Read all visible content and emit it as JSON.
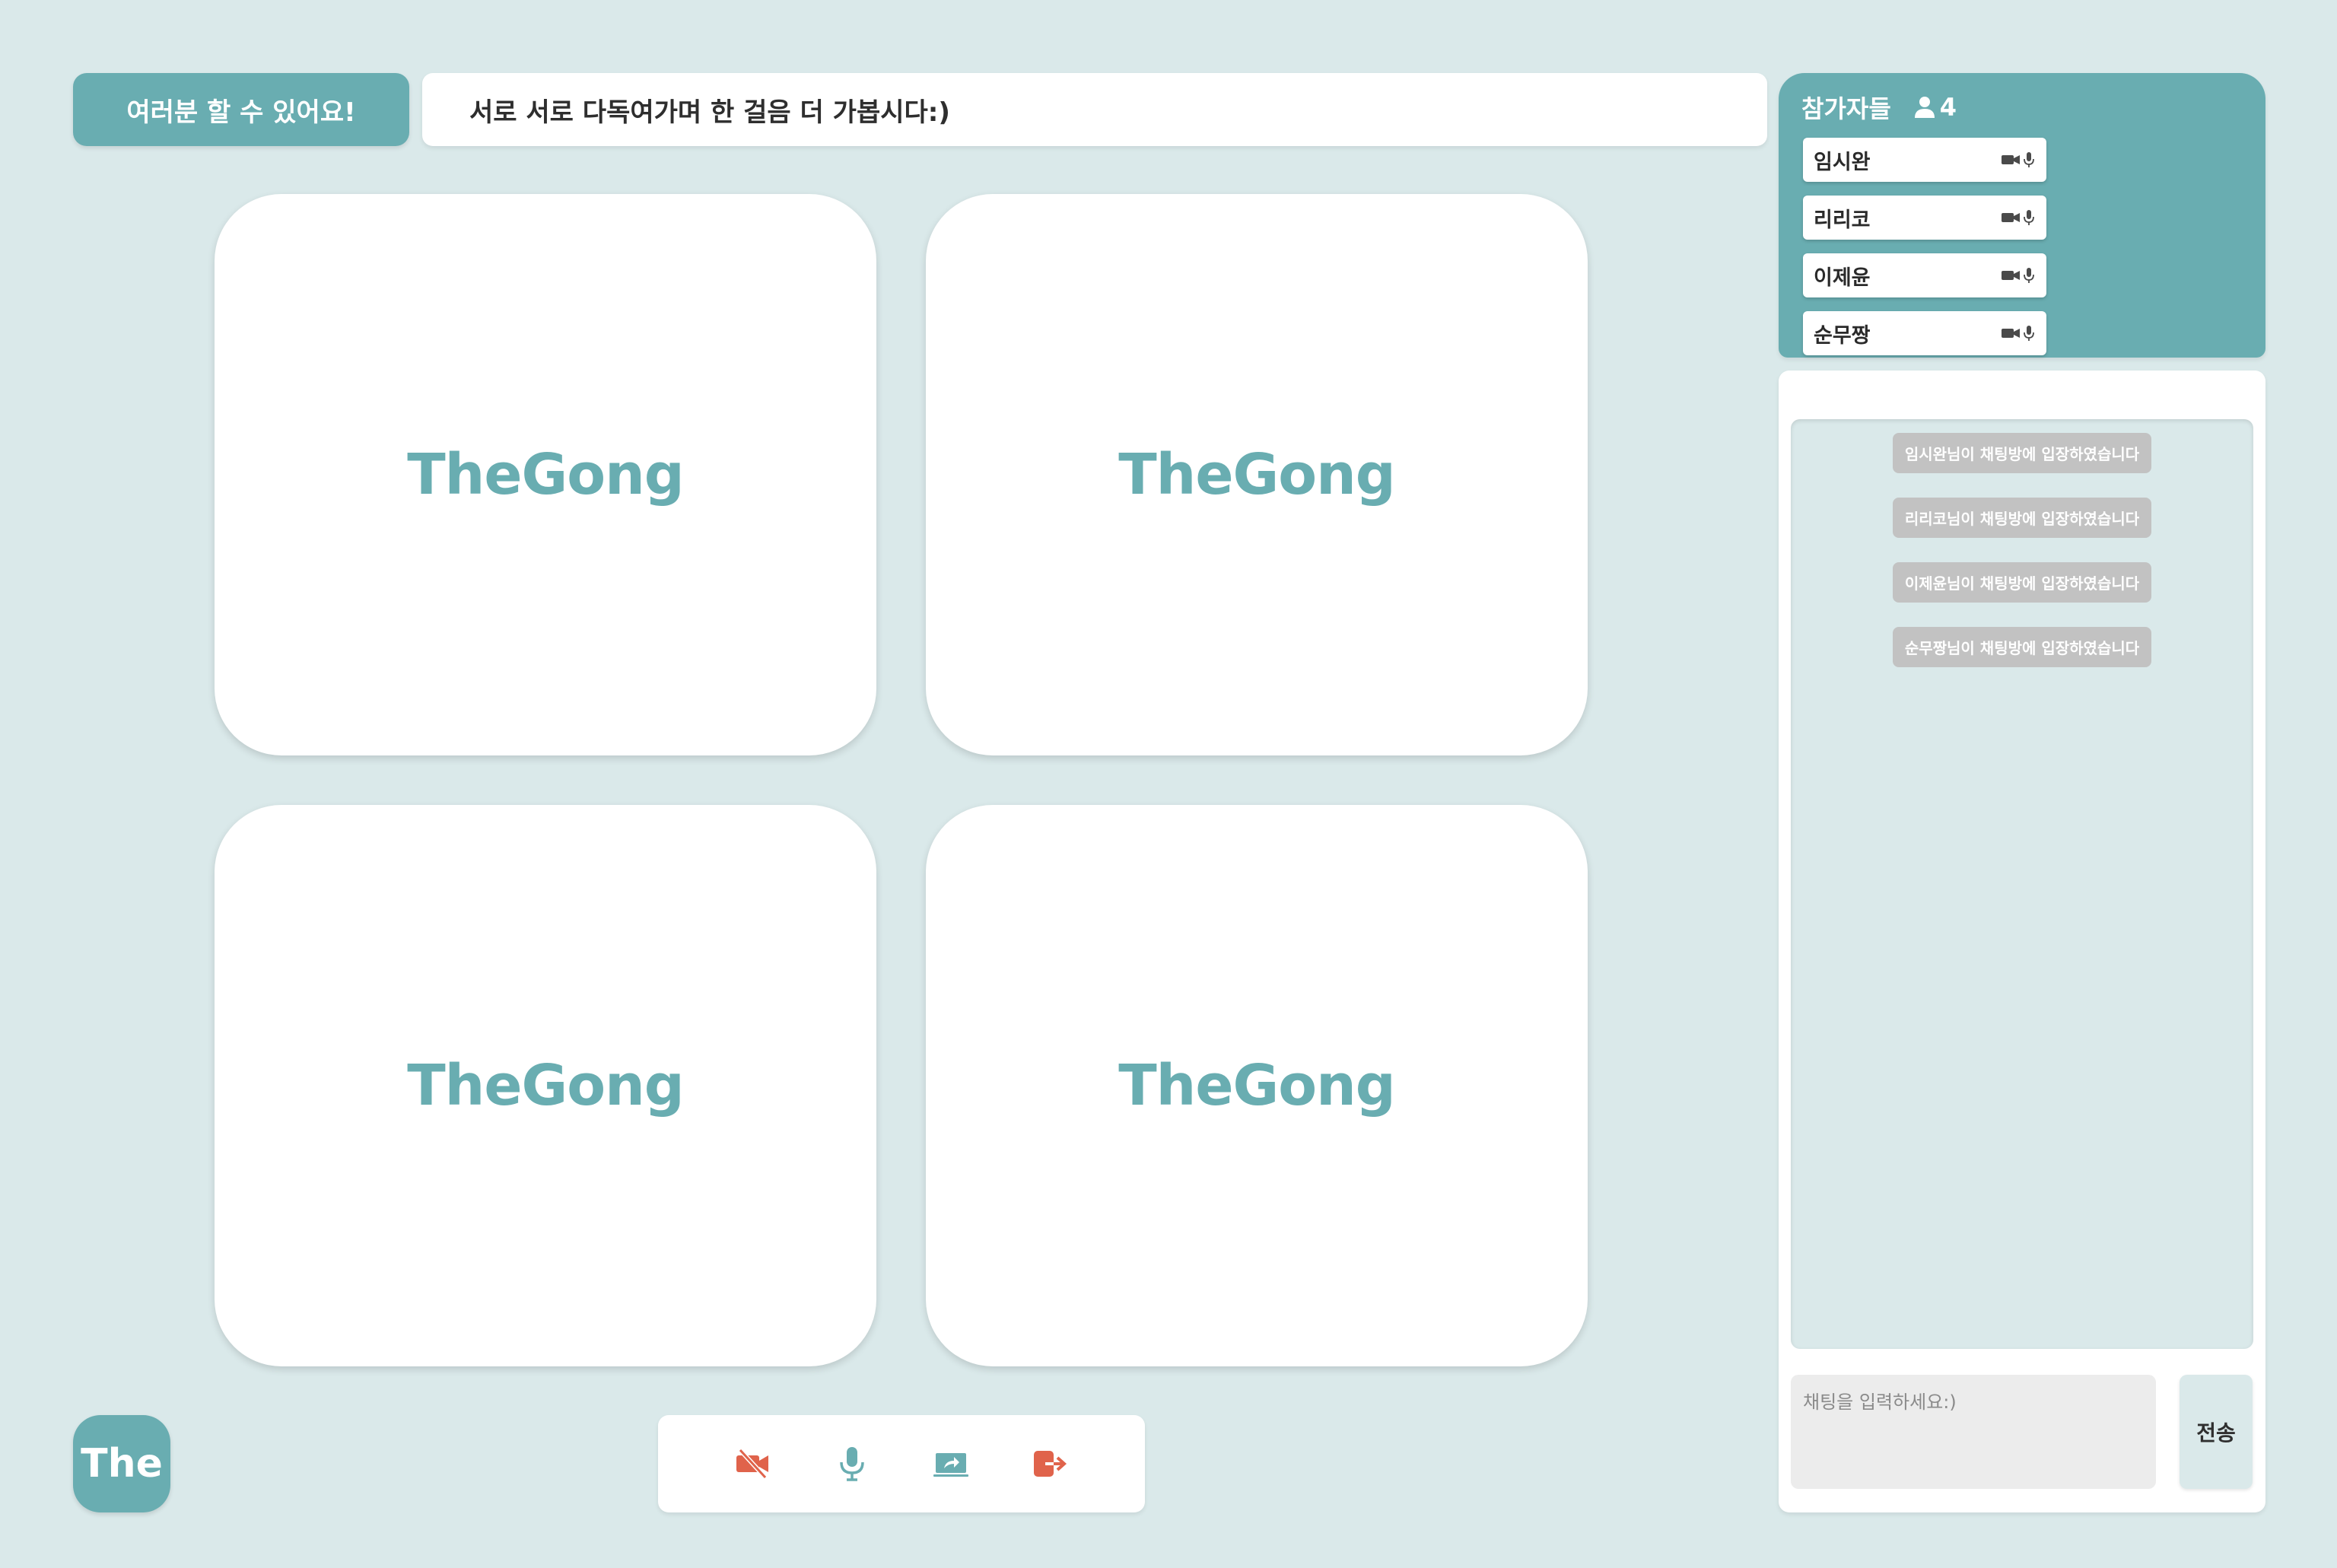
{
  "room": {
    "title": "여러분 할 수 있어요!",
    "description": "서로 서로 다독여가며 한 걸음 더 가봅시다:)"
  },
  "tiles": [
    {
      "label": "TheGong"
    },
    {
      "label": "TheGong"
    },
    {
      "label": "TheGong"
    },
    {
      "label": "TheGong"
    }
  ],
  "brand": {
    "label": "The"
  },
  "controls": {
    "icons": [
      "video-off-icon",
      "microphone-icon",
      "screen-share-icon",
      "exit-icon"
    ],
    "colors": {
      "video_off": "#e0634b",
      "mic": "#69adb1",
      "share": "#69adb1",
      "exit": "#e0634b"
    }
  },
  "participants": {
    "header": "참가자들",
    "count": "4",
    "items": [
      {
        "name": "임시완"
      },
      {
        "name": "리리코"
      },
      {
        "name": "이제윤"
      },
      {
        "name": "순무짱"
      }
    ]
  },
  "chat": {
    "messages": [
      "임시완님이 채팅방에 입장하였습니다",
      "리리코님이 채팅방에 입장하였습니다",
      "이제윤님이 채팅방에 입장하였습니다",
      "순무짱님이 채팅방에 입장하였습니다"
    ],
    "input_placeholder": "채팅을 입력하세요:)",
    "send_label": "전송"
  },
  "theme": {
    "background": "#dae9ea",
    "accent": "#69adb1",
    "danger": "#e0634b"
  }
}
